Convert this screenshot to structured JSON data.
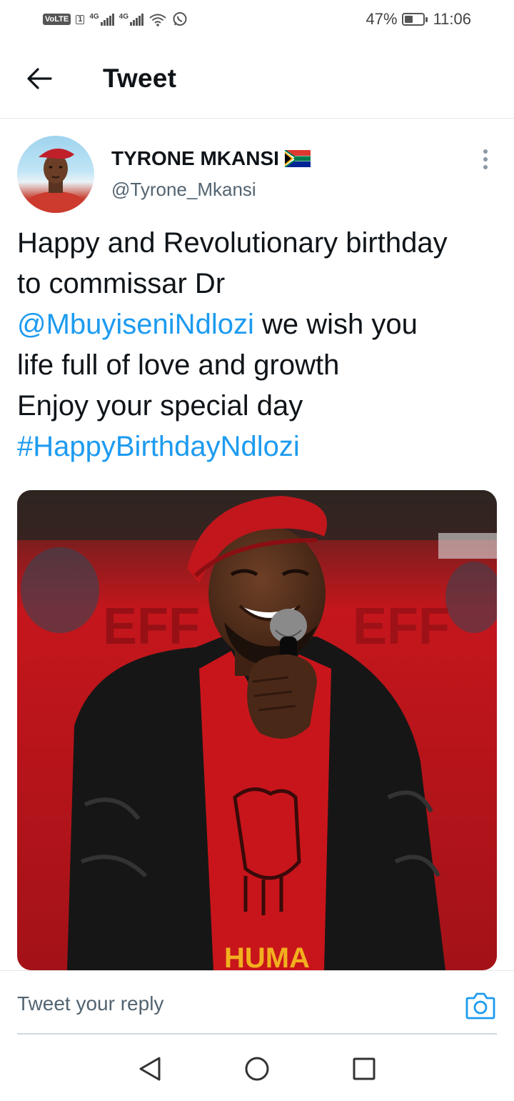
{
  "status_bar": {
    "volte": "VoLTE",
    "sim": "1",
    "network_1": "4G",
    "network_2": "4G",
    "battery_text": "47%",
    "battery_level": 0.47,
    "time": "11:06",
    "icons": [
      "signal-icon",
      "signal-icon",
      "wifi-icon",
      "whatsapp-icon",
      "battery-icon"
    ]
  },
  "header": {
    "back_icon": "arrow-left-icon",
    "title": "Tweet"
  },
  "tweet": {
    "author": {
      "name": "TYRONE MKANSI",
      "flag_icon": "south-africa-flag-icon",
      "handle": "@Tyrone_Mkansi"
    },
    "more_icon": "more-vertical-icon",
    "text": {
      "line1": "Happy and Revolutionary birthday",
      "line2": "to commissar Dr",
      "mention": "@MbuyiseniNdlozi",
      "line3_rest": " we wish you",
      "line4": "life full of love and growth",
      "line5": "Enjoy your special day",
      "hashtag": "#HappyBirthdayNdlozi"
    },
    "media": {
      "shirt_text": "HUMA",
      "banner_text": "EFF"
    }
  },
  "reply": {
    "placeholder": "Tweet your reply",
    "camera_icon": "camera-icon"
  },
  "nav": {
    "icons": [
      "back-triangle-icon",
      "home-circle-icon",
      "recents-square-icon"
    ]
  },
  "colors": {
    "link": "#1d9bf0",
    "text": "#0f1419",
    "secondary": "#536471"
  }
}
